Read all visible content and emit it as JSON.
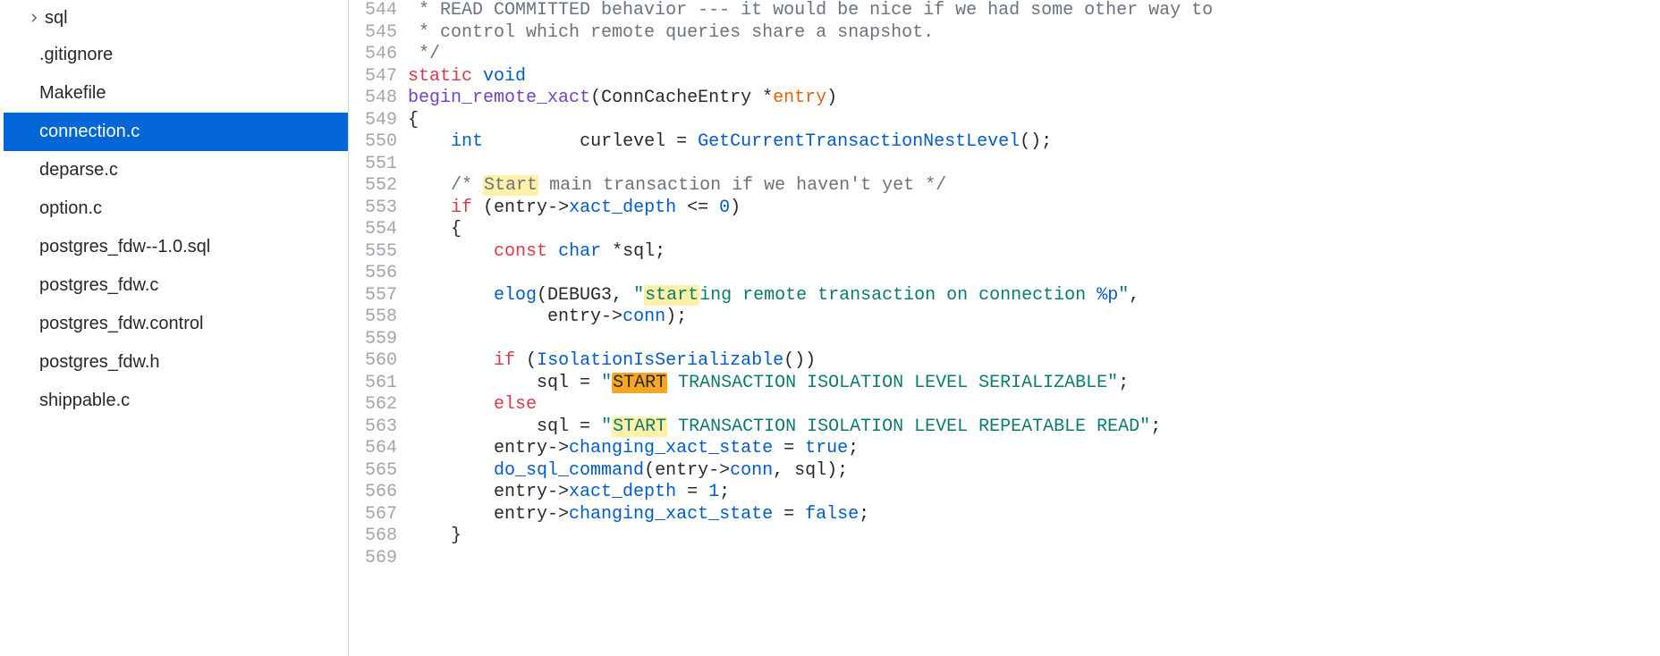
{
  "sidebar": {
    "folder": {
      "name": "sql"
    },
    "files": [
      {
        "name": ".gitignore"
      },
      {
        "name": "Makefile"
      },
      {
        "name": "connection.c",
        "selected": true
      },
      {
        "name": "deparse.c"
      },
      {
        "name": "option.c"
      },
      {
        "name": "postgres_fdw--1.0.sql"
      },
      {
        "name": "postgres_fdw.c"
      },
      {
        "name": "postgres_fdw.control"
      },
      {
        "name": "postgres_fdw.h"
      },
      {
        "name": "shippable.c"
      }
    ]
  },
  "editor": {
    "first_line_no": 544,
    "lines": [
      {
        "no": 544,
        "segs": [
          {
            "cls": "tk-comment",
            "t": " * READ COMMITTED behavior --- it would be nice if we had some other way to"
          }
        ]
      },
      {
        "no": 545,
        "segs": [
          {
            "cls": "tk-comment",
            "t": " * control which remote queries share a snapshot."
          }
        ]
      },
      {
        "no": 546,
        "segs": [
          {
            "cls": "tk-comment",
            "t": " */"
          }
        ]
      },
      {
        "no": 547,
        "segs": [
          {
            "cls": "tk-kw",
            "t": "static"
          },
          {
            "cls": "tk-plain",
            "t": " "
          },
          {
            "cls": "tk-type",
            "t": "void"
          }
        ]
      },
      {
        "no": 548,
        "segs": [
          {
            "cls": "tk-func",
            "t": "begin_remote_xact"
          },
          {
            "cls": "tk-plain",
            "t": "(ConnCacheEntry *"
          },
          {
            "cls": "tk-var",
            "t": "entry"
          },
          {
            "cls": "tk-plain",
            "t": ")"
          }
        ]
      },
      {
        "no": 549,
        "segs": [
          {
            "cls": "tk-plain",
            "t": "{"
          }
        ]
      },
      {
        "no": 550,
        "segs": [
          {
            "cls": "tk-plain",
            "t": "    "
          },
          {
            "cls": "tk-type",
            "t": "int"
          },
          {
            "cls": "tk-plain",
            "t": "         curlevel = "
          },
          {
            "cls": "tk-call",
            "t": "GetCurrentTransactionNestLevel"
          },
          {
            "cls": "tk-plain",
            "t": "();"
          }
        ]
      },
      {
        "no": 551,
        "segs": [
          {
            "cls": "tk-plain",
            "t": ""
          }
        ]
      },
      {
        "no": 552,
        "segs": [
          {
            "cls": "tk-plain",
            "t": "    "
          },
          {
            "cls": "tk-comment",
            "t": "/* "
          },
          {
            "cls": "tk-comment hl-yellow",
            "t": "Start"
          },
          {
            "cls": "tk-comment",
            "t": " main transaction if we haven't yet */"
          }
        ]
      },
      {
        "no": 553,
        "segs": [
          {
            "cls": "tk-plain",
            "t": "    "
          },
          {
            "cls": "tk-kw",
            "t": "if"
          },
          {
            "cls": "tk-plain",
            "t": " (entry->"
          },
          {
            "cls": "tk-call",
            "t": "xact_depth"
          },
          {
            "cls": "tk-plain",
            "t": " <= "
          },
          {
            "cls": "tk-num",
            "t": "0"
          },
          {
            "cls": "tk-plain",
            "t": ")"
          }
        ]
      },
      {
        "no": 554,
        "segs": [
          {
            "cls": "tk-plain",
            "t": "    {"
          }
        ]
      },
      {
        "no": 555,
        "segs": [
          {
            "cls": "tk-plain",
            "t": "        "
          },
          {
            "cls": "tk-kw",
            "t": "const"
          },
          {
            "cls": "tk-plain",
            "t": " "
          },
          {
            "cls": "tk-type",
            "t": "char"
          },
          {
            "cls": "tk-plain",
            "t": " *sql;"
          }
        ]
      },
      {
        "no": 556,
        "segs": [
          {
            "cls": "tk-plain",
            "t": ""
          }
        ]
      },
      {
        "no": 557,
        "segs": [
          {
            "cls": "tk-plain",
            "t": "        "
          },
          {
            "cls": "tk-call",
            "t": "elog"
          },
          {
            "cls": "tk-plain",
            "t": "(DEBUG3, "
          },
          {
            "cls": "tk-str",
            "t": "\""
          },
          {
            "cls": "tk-str hl-yellow",
            "t": "start"
          },
          {
            "cls": "tk-str",
            "t": "ing remote transaction on connection "
          },
          {
            "cls": "tk-type",
            "t": "%p"
          },
          {
            "cls": "tk-str",
            "t": "\""
          },
          {
            "cls": "tk-plain",
            "t": ","
          }
        ]
      },
      {
        "no": 558,
        "segs": [
          {
            "cls": "tk-plain",
            "t": "             entry->"
          },
          {
            "cls": "tk-call",
            "t": "conn"
          },
          {
            "cls": "tk-plain",
            "t": ");"
          }
        ]
      },
      {
        "no": 559,
        "segs": [
          {
            "cls": "tk-plain",
            "t": ""
          }
        ]
      },
      {
        "no": 560,
        "segs": [
          {
            "cls": "tk-plain",
            "t": "        "
          },
          {
            "cls": "tk-kw",
            "t": "if"
          },
          {
            "cls": "tk-plain",
            "t": " ("
          },
          {
            "cls": "tk-call",
            "t": "IsolationIsSerializable"
          },
          {
            "cls": "tk-plain",
            "t": "())"
          }
        ]
      },
      {
        "no": 561,
        "segs": [
          {
            "cls": "tk-plain",
            "t": "            sql = "
          },
          {
            "cls": "tk-str",
            "t": "\""
          },
          {
            "cls": "tk-str hl-orange",
            "t": "START"
          },
          {
            "cls": "tk-str",
            "t": " TRANSACTION ISOLATION LEVEL SERIALIZABLE\""
          },
          {
            "cls": "tk-plain",
            "t": ";"
          }
        ]
      },
      {
        "no": 562,
        "segs": [
          {
            "cls": "tk-plain",
            "t": "        "
          },
          {
            "cls": "tk-kw",
            "t": "else"
          }
        ]
      },
      {
        "no": 563,
        "segs": [
          {
            "cls": "tk-plain",
            "t": "            sql = "
          },
          {
            "cls": "tk-str",
            "t": "\""
          },
          {
            "cls": "tk-str hl-yellow",
            "t": "START"
          },
          {
            "cls": "tk-str",
            "t": " TRANSACTION ISOLATION LEVEL REPEATABLE READ\""
          },
          {
            "cls": "tk-plain",
            "t": ";"
          }
        ]
      },
      {
        "no": 564,
        "segs": [
          {
            "cls": "tk-plain",
            "t": "        entry->"
          },
          {
            "cls": "tk-call",
            "t": "changing_xact_state"
          },
          {
            "cls": "tk-plain",
            "t": " = "
          },
          {
            "cls": "tk-bool",
            "t": "true"
          },
          {
            "cls": "tk-plain",
            "t": ";"
          }
        ]
      },
      {
        "no": 565,
        "segs": [
          {
            "cls": "tk-plain",
            "t": "        "
          },
          {
            "cls": "tk-call",
            "t": "do_sql_command"
          },
          {
            "cls": "tk-plain",
            "t": "(entry->"
          },
          {
            "cls": "tk-call",
            "t": "conn"
          },
          {
            "cls": "tk-plain",
            "t": ", sql);"
          }
        ]
      },
      {
        "no": 566,
        "segs": [
          {
            "cls": "tk-plain",
            "t": "        entry->"
          },
          {
            "cls": "tk-call",
            "t": "xact_depth"
          },
          {
            "cls": "tk-plain",
            "t": " = "
          },
          {
            "cls": "tk-num",
            "t": "1"
          },
          {
            "cls": "tk-plain",
            "t": ";"
          }
        ]
      },
      {
        "no": 567,
        "segs": [
          {
            "cls": "tk-plain",
            "t": "        entry->"
          },
          {
            "cls": "tk-call",
            "t": "changing_xact_state"
          },
          {
            "cls": "tk-plain",
            "t": " = "
          },
          {
            "cls": "tk-bool",
            "t": "false"
          },
          {
            "cls": "tk-plain",
            "t": ";"
          }
        ]
      },
      {
        "no": 568,
        "segs": [
          {
            "cls": "tk-plain",
            "t": "    }"
          }
        ]
      },
      {
        "no": 569,
        "segs": [
          {
            "cls": "tk-plain",
            "t": ""
          }
        ]
      }
    ]
  }
}
